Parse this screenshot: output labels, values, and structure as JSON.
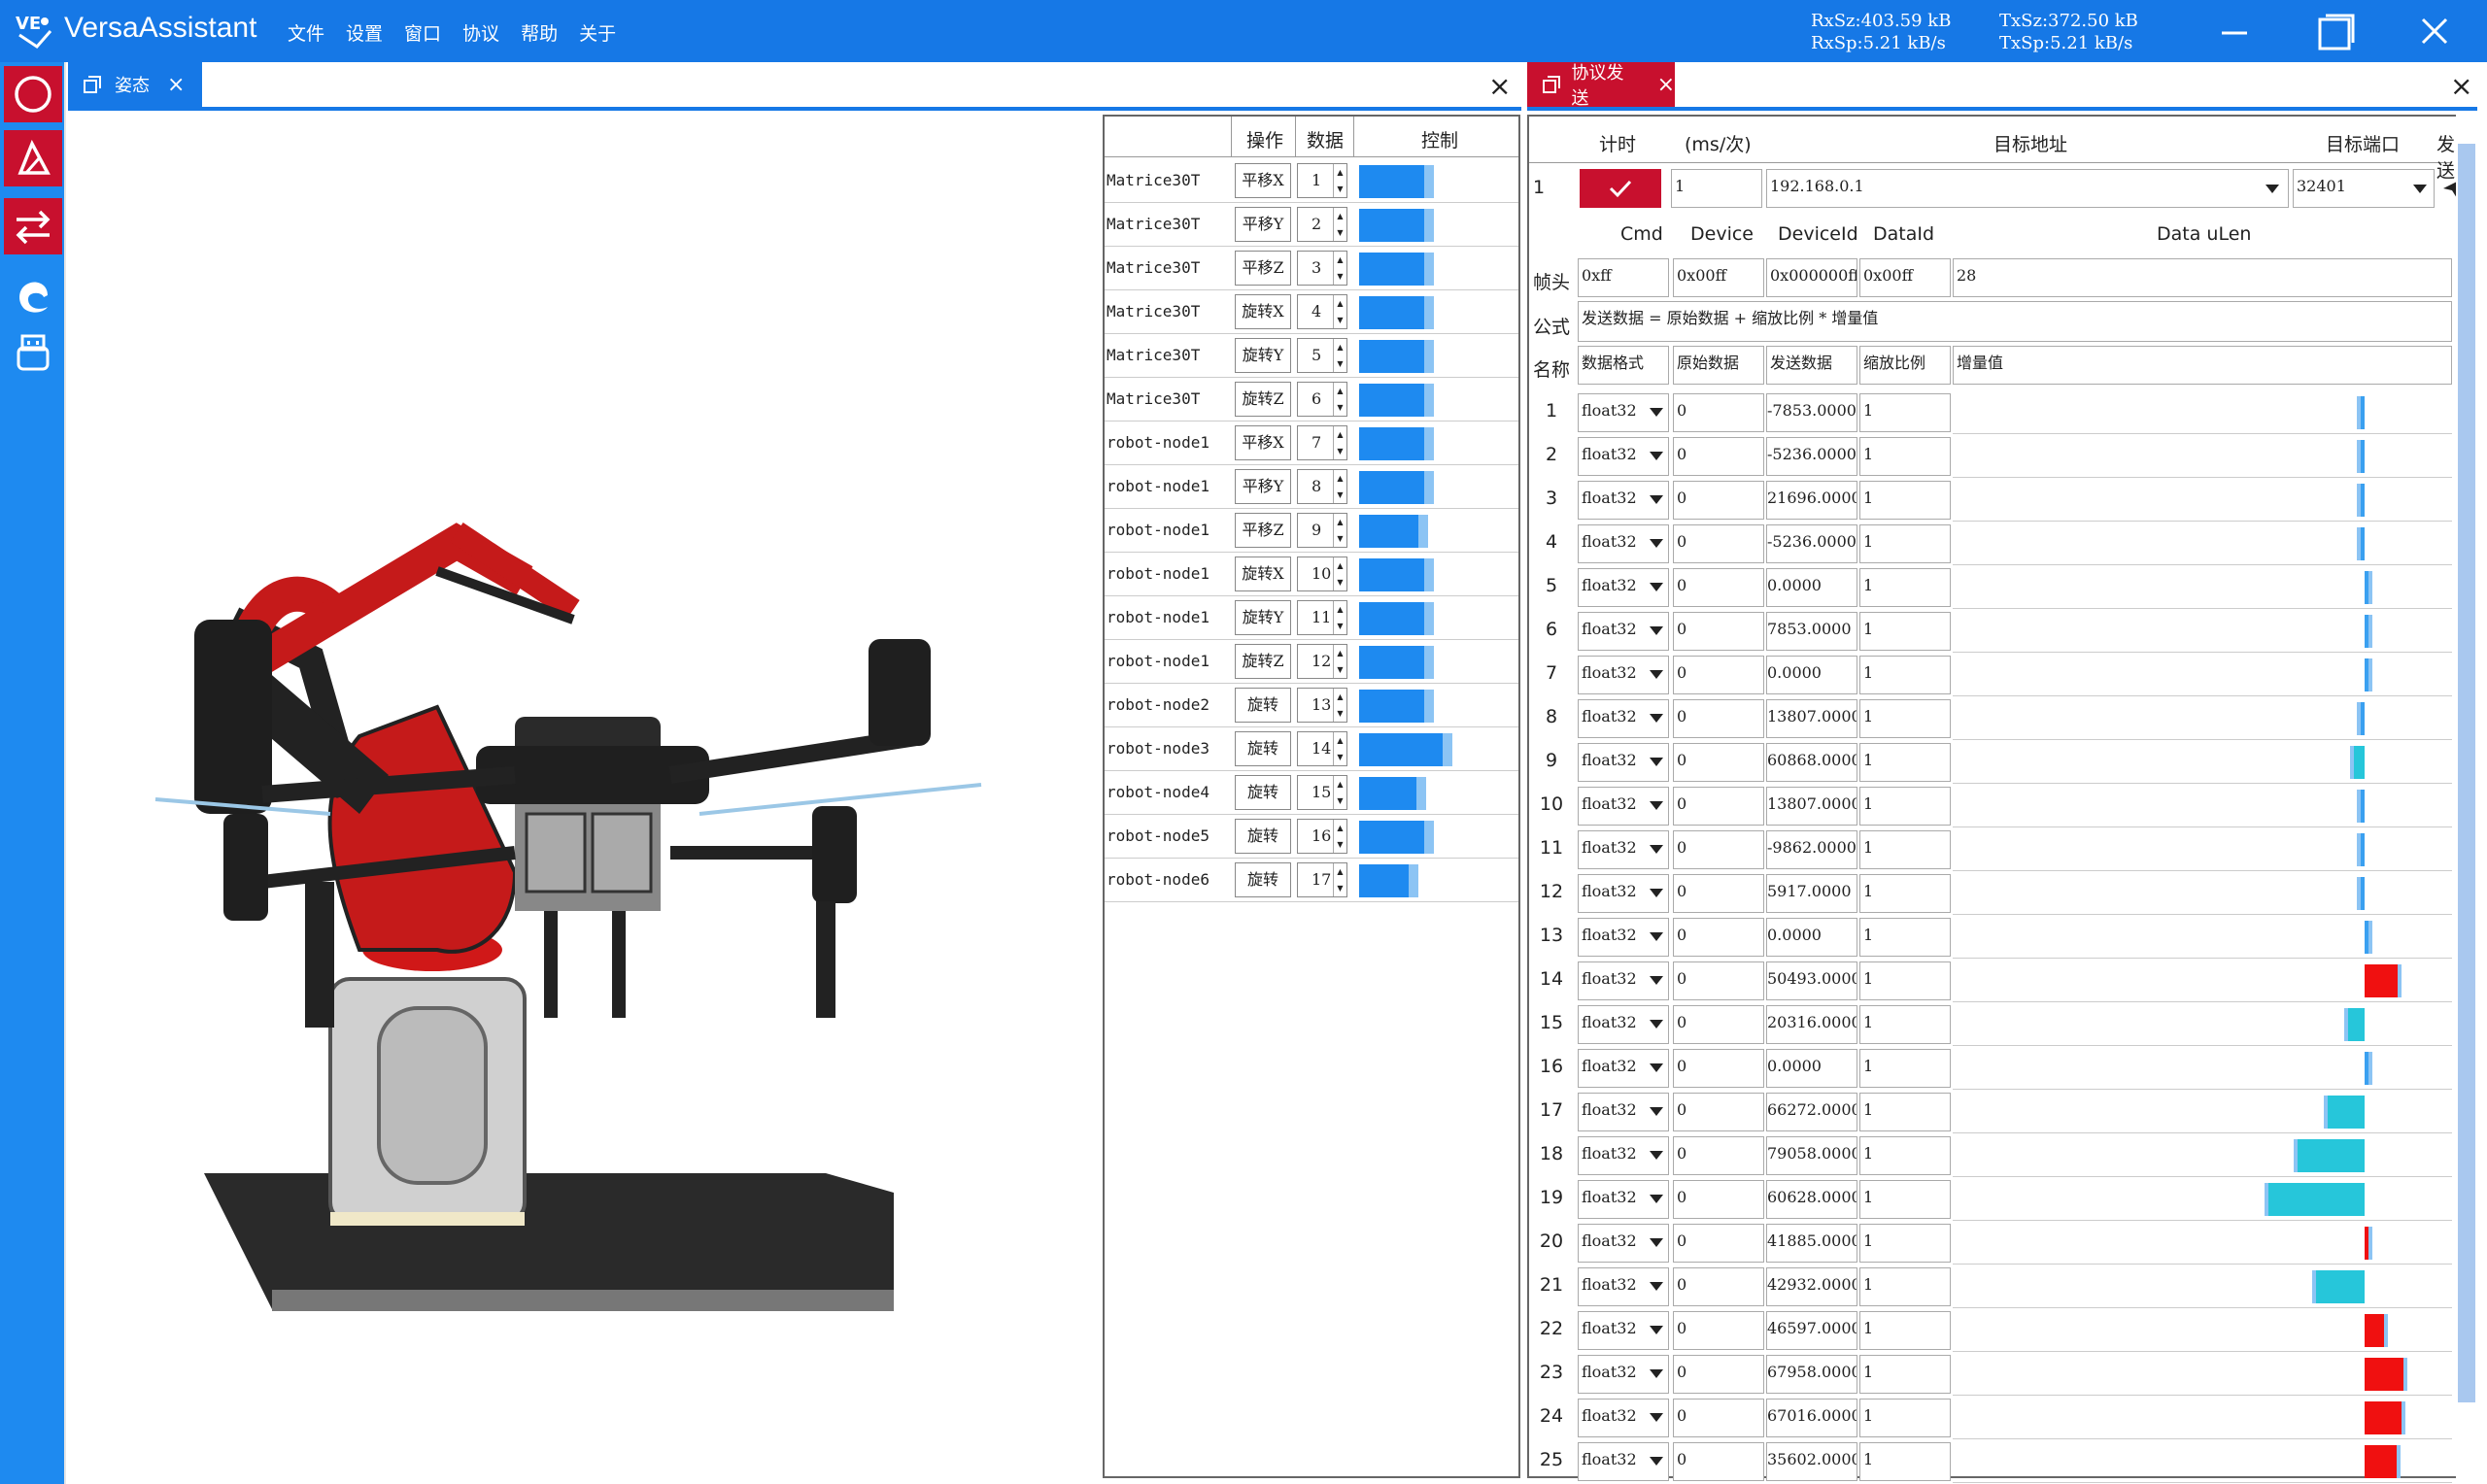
{
  "app": {
    "title": "VersaAssistant",
    "logo_text": "VE",
    "menu": [
      "文件",
      "设置",
      "窗口",
      "协议",
      "帮助",
      "关于"
    ]
  },
  "stats": {
    "rx_size": "RxSz:403.59 kB",
    "rx_speed": "RxSp:5.21 kB/s",
    "tx_size": "TxSz:372.50 kB",
    "tx_speed": "TxSp:5.21 kB/s"
  },
  "sidebar": {
    "items": [
      "circle-icon",
      "triangle-icon",
      "swap-icon",
      "edge-icon",
      "usb-icon"
    ],
    "active": [
      0,
      1,
      2
    ]
  },
  "left_tab": {
    "label": "姿态"
  },
  "right_tab": {
    "label": "协议发送"
  },
  "left_table": {
    "headers": {
      "op": "操作",
      "data": "数据",
      "control": "控制"
    },
    "rows": [
      {
        "name": "Matrice30T",
        "op": "平移X",
        "num": "1",
        "bar": 0.42
      },
      {
        "name": "Matrice30T",
        "op": "平移Y",
        "num": "2",
        "bar": 0.42
      },
      {
        "name": "Matrice30T",
        "op": "平移Z",
        "num": "3",
        "bar": 0.42
      },
      {
        "name": "Matrice30T",
        "op": "旋转X",
        "num": "4",
        "bar": 0.42
      },
      {
        "name": "Matrice30T",
        "op": "旋转Y",
        "num": "5",
        "bar": 0.42
      },
      {
        "name": "Matrice30T",
        "op": "旋转Z",
        "num": "6",
        "bar": 0.42
      },
      {
        "name": "robot-node1",
        "op": "平移X",
        "num": "7",
        "bar": 0.42
      },
      {
        "name": "robot-node1",
        "op": "平移Y",
        "num": "8",
        "bar": 0.42
      },
      {
        "name": "robot-node1",
        "op": "平移Z",
        "num": "9",
        "bar": 0.38
      },
      {
        "name": "robot-node1",
        "op": "旋转X",
        "num": "10",
        "bar": 0.42
      },
      {
        "name": "robot-node1",
        "op": "旋转Y",
        "num": "11",
        "bar": 0.42
      },
      {
        "name": "robot-node1",
        "op": "旋转Z",
        "num": "12",
        "bar": 0.42
      },
      {
        "name": "robot-node2",
        "op": "旋转",
        "num": "13",
        "bar": 0.42
      },
      {
        "name": "robot-node3",
        "op": "旋转",
        "num": "14",
        "bar": 0.54
      },
      {
        "name": "robot-node4",
        "op": "旋转",
        "num": "15",
        "bar": 0.37
      },
      {
        "name": "robot-node5",
        "op": "旋转",
        "num": "16",
        "bar": 0.42
      },
      {
        "name": "robot-node6",
        "op": "旋转",
        "num": "17",
        "bar": 0.32
      }
    ]
  },
  "protocol": {
    "header": {
      "timer": "计时",
      "interval": "(ms/次)",
      "target_addr": "目标地址",
      "target_port": "目标端口",
      "send": "发送"
    },
    "row1": {
      "index": "1",
      "interval": "1",
      "address": "192.168.0.1",
      "port": "32401"
    },
    "fields": {
      "cmd": "Cmd",
      "device": "Device",
      "device_id": "DeviceId",
      "data_id": "DataId",
      "data_ulen": "Data uLen"
    },
    "frame": {
      "label": "帧头",
      "cmd": "0xff",
      "device": "0x00ff",
      "device_id": "0x000000ff",
      "data_id": "0x00ff",
      "data_ulen": "28"
    },
    "formula": {
      "label": "公式",
      "text": "发送数据 = 原始数据 + 缩放比例 * 增量值"
    },
    "name_row": {
      "label": "名称",
      "format": "数据格式",
      "raw": "原始数据",
      "send": "发送数据",
      "scale": "缩放比例",
      "inc": "增量值"
    },
    "rows": [
      {
        "i": "1",
        "fmt": "float32",
        "raw": "0",
        "send": "-7853.0000",
        "scale": "1",
        "val": -7853,
        "color": "#3aa0f0"
      },
      {
        "i": "2",
        "fmt": "float32",
        "raw": "0",
        "send": "-5236.0000",
        "scale": "1",
        "val": -5236,
        "color": "#3aa0f0"
      },
      {
        "i": "3",
        "fmt": "float32",
        "raw": "0",
        "send": "21696.0000",
        "scale": "1",
        "val": -4000,
        "color": "#3aa0f0"
      },
      {
        "i": "4",
        "fmt": "float32",
        "raw": "0",
        "send": "-5236.0000",
        "scale": "1",
        "val": -5236,
        "color": "#3aa0f0"
      },
      {
        "i": "5",
        "fmt": "float32",
        "raw": "0",
        "send": "0.0000",
        "scale": "1",
        "val": 0,
        "color": "#3aa0f0"
      },
      {
        "i": "6",
        "fmt": "float32",
        "raw": "0",
        "send": "7853.0000",
        "scale": "1",
        "val": 4000,
        "color": "#3aa0f0"
      },
      {
        "i": "7",
        "fmt": "float32",
        "raw": "0",
        "send": "0.0000",
        "scale": "1",
        "val": 0,
        "color": "#3aa0f0"
      },
      {
        "i": "8",
        "fmt": "float32",
        "raw": "0",
        "send": "13807.0000",
        "scale": "1",
        "val": -4000,
        "color": "#3aa0f0"
      },
      {
        "i": "9",
        "fmt": "float32",
        "raw": "0",
        "send": "60868.0000",
        "scale": "1",
        "val": -22000,
        "color": "#26c6da"
      },
      {
        "i": "10",
        "fmt": "float32",
        "raw": "0",
        "send": "13807.0000",
        "scale": "1",
        "val": -4000,
        "color": "#3aa0f0"
      },
      {
        "i": "11",
        "fmt": "float32",
        "raw": "0",
        "send": "-9862.0000",
        "scale": "1",
        "val": -4000,
        "color": "#3aa0f0"
      },
      {
        "i": "12",
        "fmt": "float32",
        "raw": "0",
        "send": "5917.0000",
        "scale": "1",
        "val": -4000,
        "color": "#3aa0f0"
      },
      {
        "i": "13",
        "fmt": "float32",
        "raw": "0",
        "send": "0.0000",
        "scale": "1",
        "val": 0,
        "color": "#3aa0f0"
      },
      {
        "i": "14",
        "fmt": "float32",
        "raw": "0",
        "send": "50493.0000",
        "scale": "1",
        "val": 60000,
        "color": "#f01010"
      },
      {
        "i": "15",
        "fmt": "float32",
        "raw": "0",
        "send": "20316.0000",
        "scale": "1",
        "val": -32000,
        "color": "#26c6da"
      },
      {
        "i": "16",
        "fmt": "float32",
        "raw": "0",
        "send": "0.0000",
        "scale": "1",
        "val": 0,
        "color": "#3aa0f0"
      },
      {
        "i": "17",
        "fmt": "float32",
        "raw": "0",
        "send": "66272.0000",
        "scale": "1",
        "val": -66000,
        "color": "#26c6da"
      },
      {
        "i": "18",
        "fmt": "float32",
        "raw": "0",
        "send": "79058.0000",
        "scale": "1",
        "val": -118000,
        "color": "#26c6da"
      },
      {
        "i": "19",
        "fmt": "float32",
        "raw": "0",
        "send": "60628.0000",
        "scale": "1",
        "val": -168000,
        "color": "#26c6da"
      },
      {
        "i": "20",
        "fmt": "float32",
        "raw": "0",
        "send": "41885.0000",
        "scale": "1",
        "val": 9000,
        "color": "#f01010"
      },
      {
        "i": "21",
        "fmt": "float32",
        "raw": "0",
        "send": "42932.0000",
        "scale": "1",
        "val": -86000,
        "color": "#26c6da"
      },
      {
        "i": "22",
        "fmt": "float32",
        "raw": "0",
        "send": "46597.0000",
        "scale": "1",
        "val": 36000,
        "color": "#f01010"
      },
      {
        "i": "23",
        "fmt": "float32",
        "raw": "0",
        "send": "67958.0000",
        "scale": "1",
        "val": 70000,
        "color": "#f01010"
      },
      {
        "i": "24",
        "fmt": "float32",
        "raw": "0",
        "send": "67016.0000",
        "scale": "1",
        "val": 66000,
        "color": "#f01010"
      },
      {
        "i": "25",
        "fmt": "float32",
        "raw": "0",
        "send": "35602.0000",
        "scale": "1",
        "val": 58000,
        "color": "#f01010"
      }
    ]
  }
}
